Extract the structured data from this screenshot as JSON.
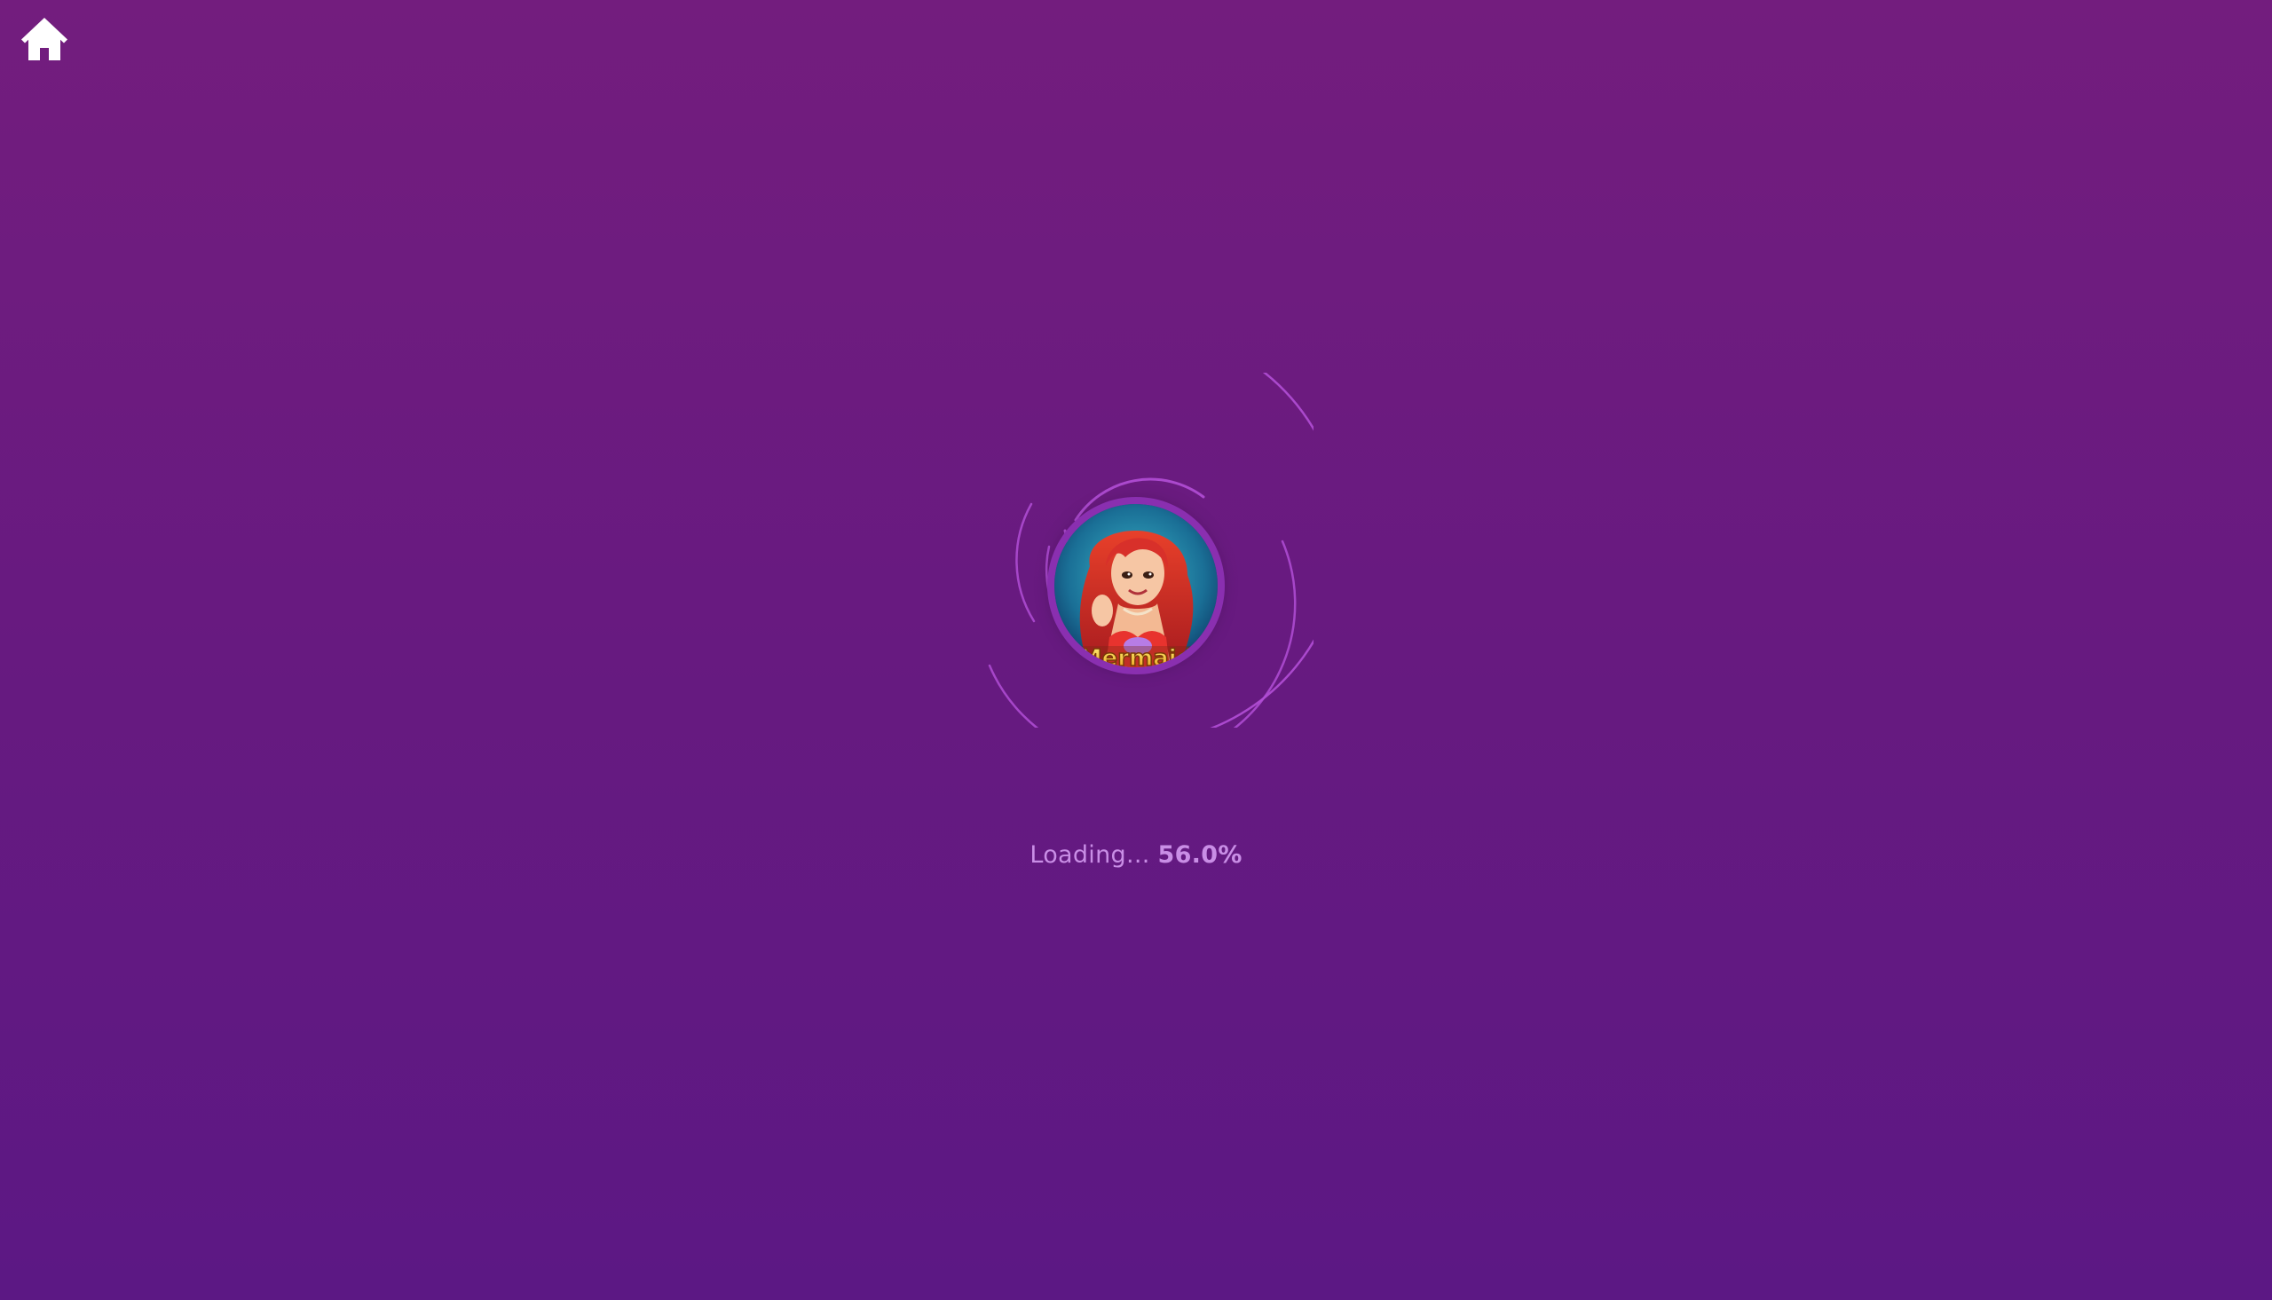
{
  "icons": {
    "home": "home-icon"
  },
  "loader": {
    "label": "Loading...",
    "percent_text": "56.0%",
    "progress": 56.0,
    "game_logo_text": "Mermaid"
  },
  "colors": {
    "background_top": "#731d7e",
    "background_bottom": "#5c1884",
    "ring": "#b24fd6",
    "text": "#c98ee6"
  }
}
